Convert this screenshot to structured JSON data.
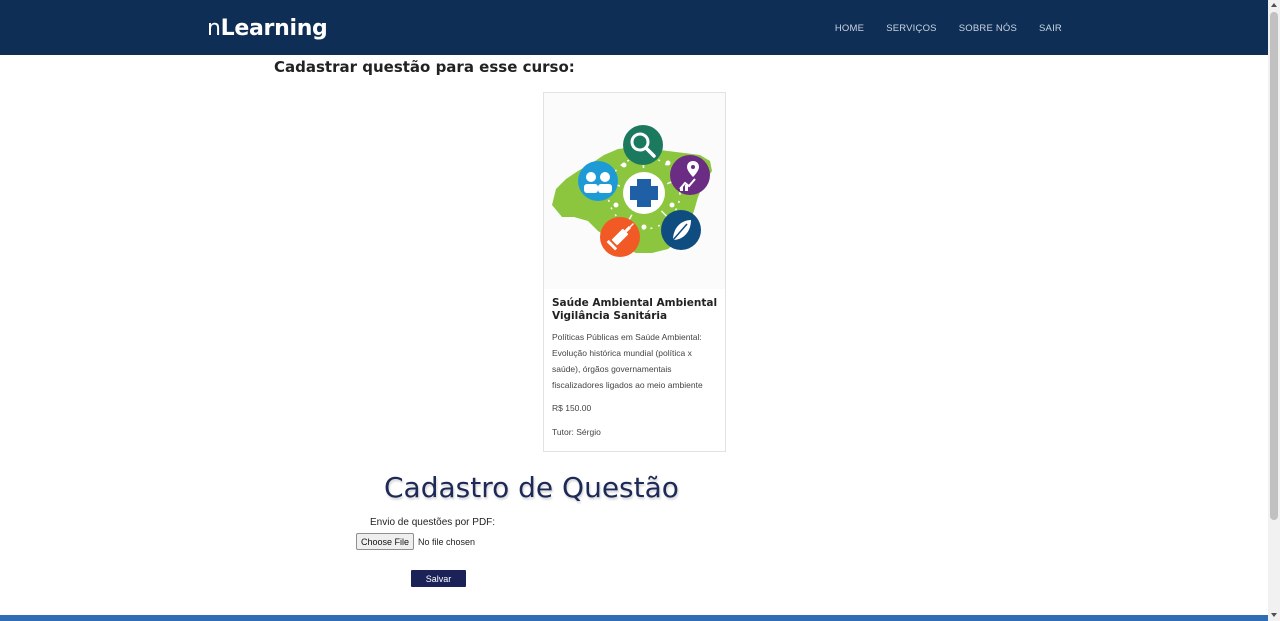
{
  "navbar": {
    "brand_prefix": "n",
    "brand_main": "Learning",
    "items": [
      {
        "label": "HOME"
      },
      {
        "label": "SERVIÇOS"
      },
      {
        "label": "SOBRE NÓS"
      },
      {
        "label": "SAIR"
      }
    ],
    "background_color": "#0f2e55"
  },
  "page": {
    "section_title": "Cadastrar questão para esse curso:"
  },
  "course_card": {
    "title": "Saúde Ambiental Ambiental Vigilância Sanitária",
    "description": "Políticas Públicas em Saúde Ambiental: Evolução histórica mundial (política x saúde), órgãos governamentais fiscalizadores ligados ao meio ambiente",
    "price": "R$ 150.00",
    "tutor": "Tutor: Sérgio",
    "image_icons": [
      "magnifier-icon",
      "people-icon",
      "map-chart-icon",
      "health-cross-icon",
      "syringe-icon",
      "leaf-icon"
    ]
  },
  "form": {
    "title": "Cadastro de Questão",
    "pdf_label": "Envio de questões por PDF:",
    "file_button": "Choose File",
    "file_status": "No file chosen",
    "submit_label": "Salvar",
    "submit_color": "#1a2257"
  },
  "footer": {
    "color": "#2f6db5"
  }
}
